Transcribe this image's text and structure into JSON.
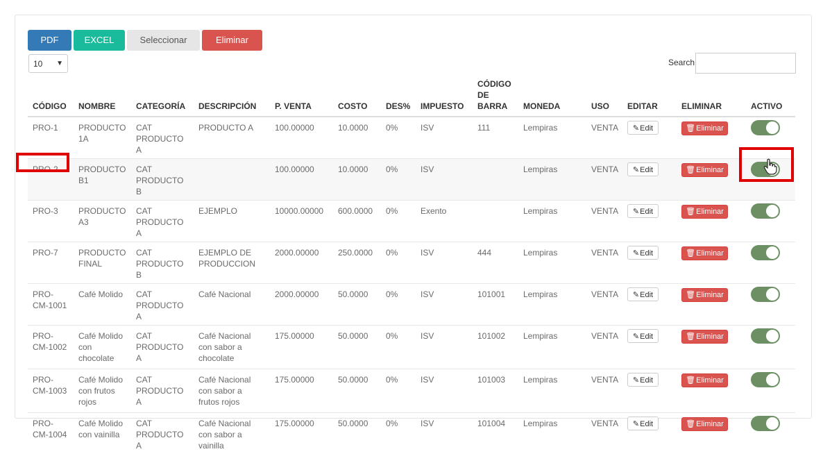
{
  "toolbar": {
    "pdf_label": "PDF",
    "excel_label": "EXCEL",
    "select_label": "Seleccionar",
    "delete_label": "Eliminar",
    "colors": {
      "pdf": "#337ab7",
      "excel": "#1abb9c",
      "delete": "#d9534f"
    }
  },
  "page_length": {
    "value": "10"
  },
  "search": {
    "label": "Search:",
    "value": ""
  },
  "table": {
    "headers": [
      "CÓDIGO",
      "NOMBRE",
      "CATEGORÍA",
      "DESCRIPCIÓN",
      "P. VENTA",
      "COSTO",
      "DES%",
      "IMPUESTO",
      "CÓDIGO DE BARRA",
      "MONEDA",
      "USO",
      "EDITAR",
      "ELIMINAR",
      "ACTIVO"
    ],
    "edit_label": "Edit",
    "delete_label": "Eliminar",
    "rows": [
      {
        "codigo": "PRO-1",
        "nombre": "PRODUCTO 1A",
        "categoria": "CAT PRODUCTO A",
        "descripcion": "PRODUCTO A",
        "venta": "100.00000",
        "costo": "10.0000",
        "des": "0%",
        "impuesto": "ISV",
        "barra": "111",
        "moneda": "Lempiras",
        "uso": "VENTA",
        "activo": true
      },
      {
        "codigo": "PRO-2",
        "nombre": "PRODUCTO B1",
        "categoria": "CAT PRODUCTO B",
        "descripcion": "",
        "venta": "100.00000",
        "costo": "10.0000",
        "des": "0%",
        "impuesto": "ISV",
        "barra": "",
        "moneda": "Lempiras",
        "uso": "VENTA",
        "activo": true
      },
      {
        "codigo": "PRO-3",
        "nombre": "PRODUCTO A3",
        "categoria": "CAT PRODUCTO A",
        "descripcion": "EJEMPLO",
        "venta": "10000.00000",
        "costo": "600.0000",
        "des": "0%",
        "impuesto": "Exento",
        "barra": "",
        "moneda": "Lempiras",
        "uso": "VENTA",
        "activo": true
      },
      {
        "codigo": "PRO-7",
        "nombre": "PRODUCTO FINAL",
        "categoria": "CAT PRODUCTO B",
        "descripcion": "EJEMPLO DE PRODUCCION",
        "venta": "2000.00000",
        "costo": "250.0000",
        "des": "0%",
        "impuesto": "ISV",
        "barra": "444",
        "moneda": "Lempiras",
        "uso": "VENTA",
        "activo": true
      },
      {
        "codigo": "PRO-CM-1001",
        "nombre": "Café Molido",
        "categoria": "CAT PRODUCTO A",
        "descripcion": "Café Nacional",
        "venta": "2000.00000",
        "costo": "50.0000",
        "des": "0%",
        "impuesto": "ISV",
        "barra": "101001",
        "moneda": "Lempiras",
        "uso": "VENTA",
        "activo": true
      },
      {
        "codigo": "PRO-CM-1002",
        "nombre": "Café Molido con chocolate",
        "categoria": "CAT PRODUCTO A",
        "descripcion": "Café Nacional con sabor a chocolate",
        "venta": "175.00000",
        "costo": "50.0000",
        "des": "0%",
        "impuesto": "ISV",
        "barra": "101002",
        "moneda": "Lempiras",
        "uso": "VENTA",
        "activo": true
      },
      {
        "codigo": "PRO-CM-1003",
        "nombre": "Café Molido con frutos rojos",
        "categoria": "CAT PRODUCTO A",
        "descripcion": "Café Nacional con sabor a frutos rojos",
        "venta": "175.00000",
        "costo": "50.0000",
        "des": "0%",
        "impuesto": "ISV",
        "barra": "101003",
        "moneda": "Lempiras",
        "uso": "VENTA",
        "activo": true
      },
      {
        "codigo": "PRO-CM-1004",
        "nombre": "Café Molido con vainilla",
        "categoria": "CAT PRODUCTO A",
        "descripcion": "Café Nacional con sabor a vainilla",
        "venta": "175.00000",
        "costo": "50.0000",
        "des": "0%",
        "impuesto": "ISV",
        "barra": "101004",
        "moneda": "Lempiras",
        "uso": "VENTA",
        "activo": true
      }
    ]
  },
  "toggle_color": "#6c9064",
  "highlight_color": "#e00000",
  "icons": {
    "edit": "pencil-icon",
    "delete": "trash-icon",
    "cursor": "hand-pointer-icon",
    "length": "chevron-down-icon"
  }
}
